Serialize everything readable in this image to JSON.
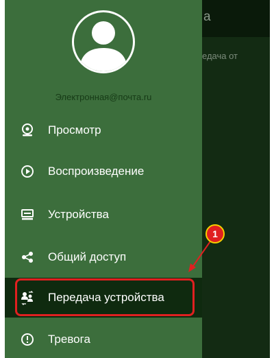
{
  "background": {
    "title_fragment": "а",
    "text_fragment": "едача от"
  },
  "drawer": {
    "email": "Электронная@почта.ru",
    "items": [
      {
        "label": "Просмотр",
        "icon": "camera-icon"
      },
      {
        "label": "Воспроизведение",
        "icon": "play-circle-icon"
      },
      {
        "label": "Устройства",
        "icon": "device-icon"
      },
      {
        "label": "Общий доступ",
        "icon": "share-icon"
      },
      {
        "label": "Передача устройства",
        "icon": "transfer-users-icon",
        "active": true
      },
      {
        "label": "Тревога",
        "icon": "alarm-icon"
      }
    ]
  },
  "annotation": {
    "callout_number": "1",
    "color": "#e02020",
    "outline": "#f5d000"
  },
  "colors": {
    "drawer": "#3c6e3c",
    "active_item": "#0f2a0f",
    "email": "#163a16"
  }
}
